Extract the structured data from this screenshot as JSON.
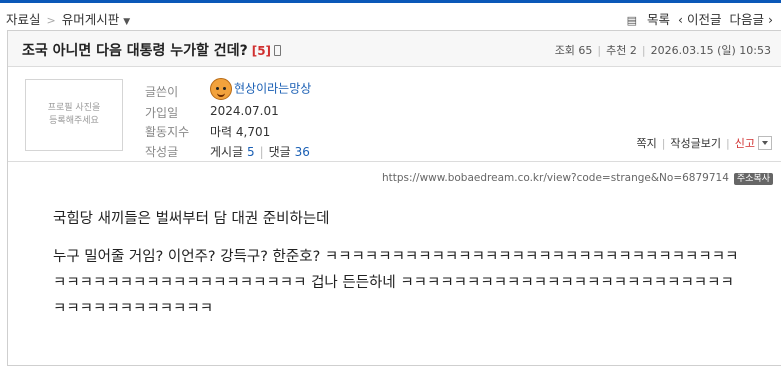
{
  "breadcrumb": {
    "home": "자료실",
    "separator": ">",
    "board": "유머게시판",
    "caret": "▼"
  },
  "pager": {
    "list_icon": "list-icon",
    "list": "목록",
    "prev": "‹ 이전글",
    "next": "다음글 ›"
  },
  "post": {
    "title": "조국 아니면 다음 대통령 누가할 건데?",
    "comment_count": "[5]",
    "views": "조회 65",
    "recommend": "추천 2",
    "date": "2026.03.15 (일) 10:53"
  },
  "author": {
    "photo_placeholder": "프로필 사진을\n등록해주세요",
    "labels": {
      "writer": "글쓴이",
      "joined": "가입일",
      "activity": "활동지수",
      "posts": "작성글"
    },
    "nickname": "현상이라는망상",
    "joined": "2024.07.01",
    "activity": "마력 4,701",
    "post_count_label": "게시글",
    "post_count": "5",
    "comment_count_label": "댓글",
    "comment_count": "36"
  },
  "actions": {
    "message": "쪽지",
    "view_posts": "작성글보기",
    "report": "신고"
  },
  "url": {
    "text": "https://www.bobaedream.co.kr/view?code=strange&No=6879714",
    "copy": "주소복사"
  },
  "content": {
    "paragraph1": "국힘당 새끼들은 벌써부터 담 대권 준비하는데",
    "paragraph2": "누구 밀어줄 거임? 이언주? 강득구? 한준호? ㅋㅋㅋㅋㅋㅋㅋㅋㅋㅋㅋㅋㅋㅋㅋㅋㅋㅋㅋㅋㅋㅋㅋㅋㅋㅋㅋㅋㅋㅋㅋㅋㅋㅋㅋㅋㅋㅋㅋㅋㅋㅋㅋㅋㅋㅋㅋㅋㅋㅋ 겁나 든든하네 ㅋㅋㅋㅋㅋㅋㅋㅋㅋㅋㅋㅋㅋㅋㅋㅋㅋㅋㅋㅋㅋㅋㅋㅋㅋㅋㅋㅋㅋㅋㅋㅋㅋㅋㅋㅋㅋ"
  },
  "colors": {
    "accent": "#0b58b8",
    "link": "#1a5fb4",
    "alert": "#d03030"
  }
}
